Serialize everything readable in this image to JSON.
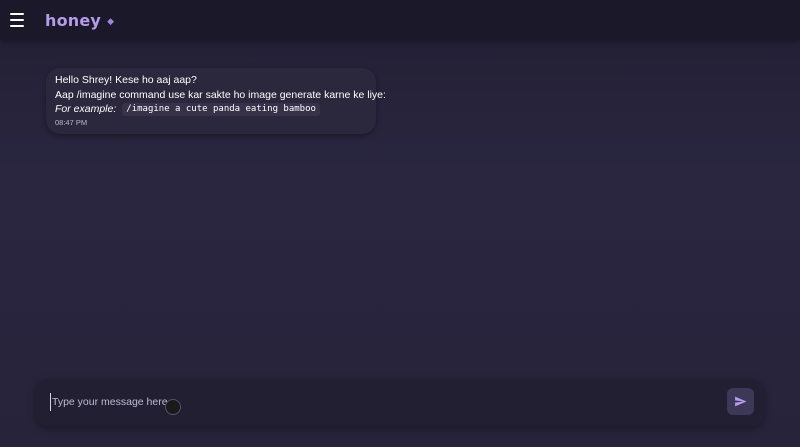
{
  "header": {
    "brand": "honey",
    "brand_icon": "diamond-icon",
    "menu_icon": "hamburger-menu-icon"
  },
  "messages": [
    {
      "greeting": "Hello Shrey! Kese ho aaj aap?",
      "instruction": "Aap /imagine command use kar sakte ho image generate karne ke liye:",
      "example_label": "For example:",
      "example_code": "/imagine a cute panda eating bamboo",
      "time": "08:47 PM"
    }
  ],
  "composer": {
    "placeholder": "Type your message here...",
    "value": "",
    "send_icon": "send-icon"
  },
  "colors": {
    "background": "#27233b",
    "header": "#1b1829",
    "brand": "#b59ce8",
    "bubble": "#2b273c",
    "send_button": "#3d3858"
  }
}
